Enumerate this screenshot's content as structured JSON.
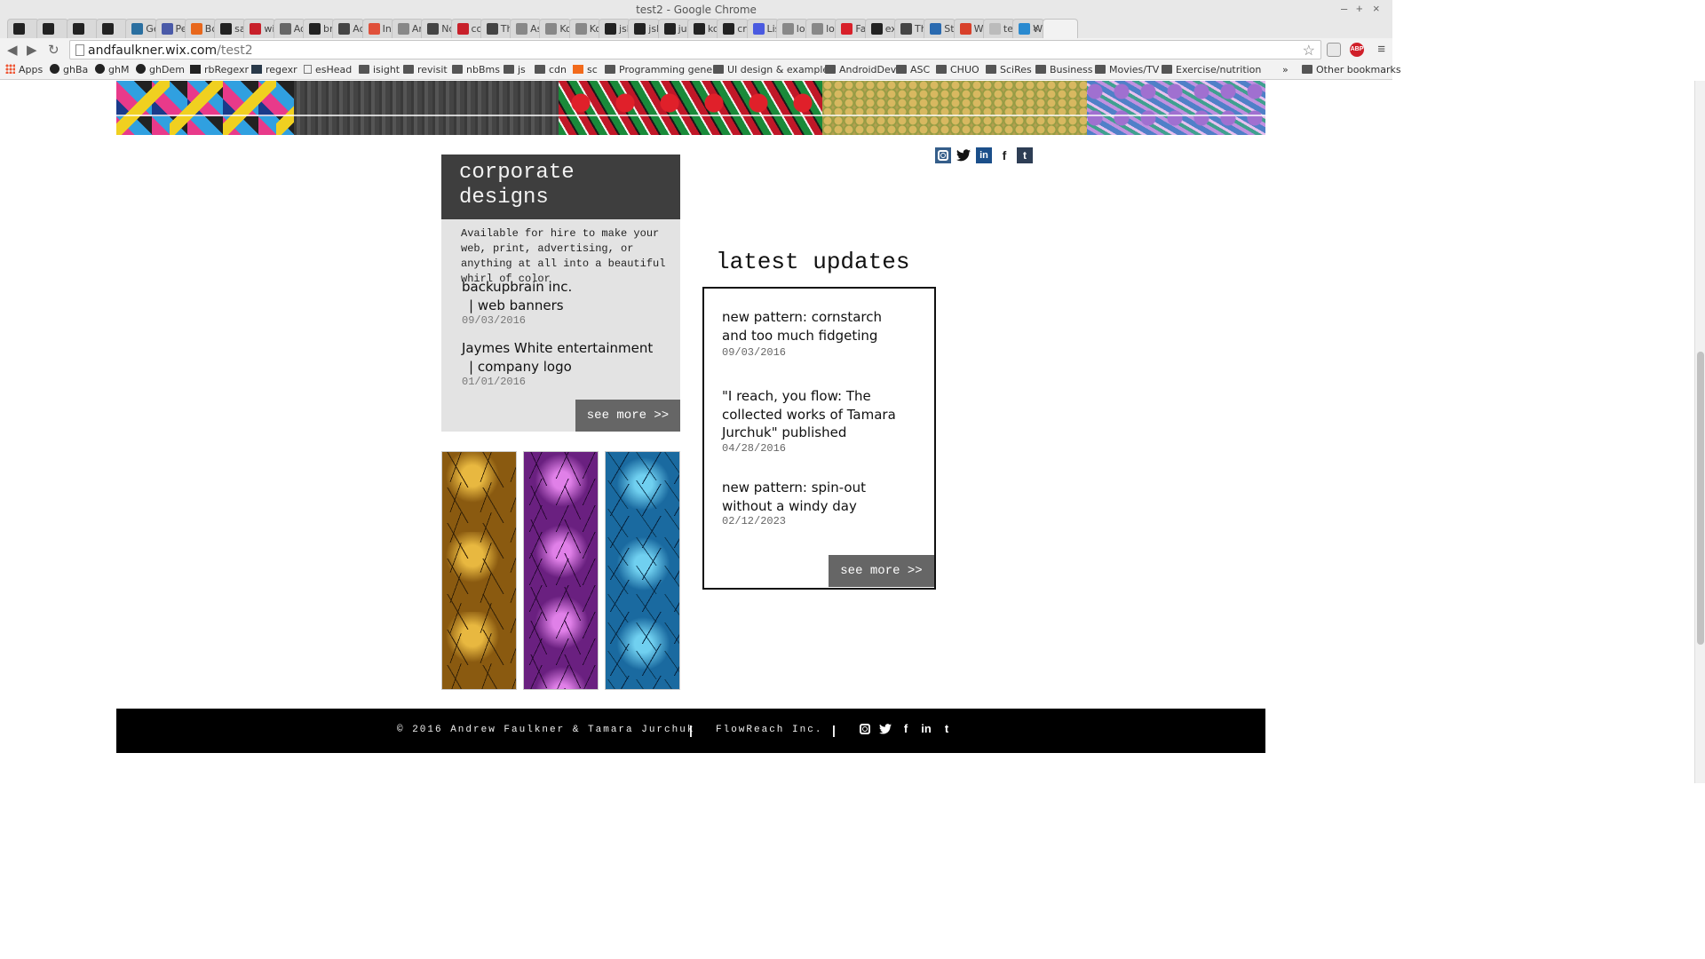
{
  "window": {
    "title": "test2 - Google Chrome",
    "minimize": "–",
    "maximize": "+",
    "close": "×"
  },
  "tabs": [
    {
      "label": "",
      "icon": "github-icon",
      "color": "#222222"
    },
    {
      "label": "",
      "icon": "lambda-icon",
      "color": "#222222"
    },
    {
      "label": "",
      "icon": "hackerrank-icon",
      "color": "#222222"
    },
    {
      "label": "",
      "icon": "book-icon",
      "color": "#222222"
    },
    {
      "label": "Ge",
      "icon": "react-icon",
      "color": "#2a6fa0"
    },
    {
      "label": "Per",
      "icon": "h-icon",
      "color": "#4a5aa8"
    },
    {
      "label": "Bo",
      "icon": "orange-circle-icon",
      "color": "#e8671c"
    },
    {
      "label": "sas",
      "icon": "github-icon",
      "color": "#222222"
    },
    {
      "label": "wi",
      "icon": "n-red-icon",
      "color": "#c8202a"
    },
    {
      "label": "Ad",
      "icon": "dos-icon",
      "color": "#666666"
    },
    {
      "label": "bro",
      "icon": "github-icon",
      "color": "#222222"
    },
    {
      "label": "Act",
      "icon": "book-icon",
      "color": "#444444"
    },
    {
      "label": "Intr",
      "icon": "plus-icon",
      "color": "#e0503a"
    },
    {
      "label": "An",
      "icon": "page-icon",
      "color": "#888888"
    },
    {
      "label": "No",
      "icon": "circle-2-icon",
      "color": "#444444"
    },
    {
      "label": "co",
      "icon": "n-red-icon",
      "color": "#c8202a"
    },
    {
      "label": "The",
      "icon": "book-icon",
      "color": "#444444"
    },
    {
      "label": "Asy",
      "icon": "page-icon",
      "color": "#888888"
    },
    {
      "label": "Ko",
      "icon": "page-icon",
      "color": "#888888"
    },
    {
      "label": "Ko",
      "icon": "page-icon",
      "color": "#888888"
    },
    {
      "label": "jsh",
      "icon": "github-icon",
      "color": "#222222"
    },
    {
      "label": "jsh",
      "icon": "github-icon",
      "color": "#222222"
    },
    {
      "label": "just",
      "icon": "github-icon",
      "color": "#222222"
    },
    {
      "label": "koa",
      "icon": "github-icon",
      "color": "#222222"
    },
    {
      "label": "cry",
      "icon": "github-icon",
      "color": "#222222"
    },
    {
      "label": "List",
      "icon": "blue-circle-icon",
      "color": "#4a5ae0"
    },
    {
      "label": "loc",
      "icon": "page-icon",
      "color": "#888888"
    },
    {
      "label": "loc",
      "icon": "page-icon",
      "color": "#888888"
    },
    {
      "label": "Fav",
      "icon": "f-red-icon",
      "color": "#d8202a"
    },
    {
      "label": "exp",
      "icon": "github-icon",
      "color": "#222222"
    },
    {
      "label": "Thr",
      "icon": "book-icon",
      "color": "#444444"
    },
    {
      "label": "Sto",
      "icon": "c-blue-icon",
      "color": "#2a6ab0"
    },
    {
      "label": "Wir",
      "icon": "gmail-icon",
      "color": "#d8402a"
    },
    {
      "label": "tes",
      "icon": "loading-icon",
      "color": "#bbbbbb"
    },
    {
      "label": "Wix",
      "icon": "x-blue-icon",
      "color": "#2a8ad0"
    },
    {
      "label": "",
      "icon": "active-tab",
      "color": "#f2f2f2"
    }
  ],
  "toolbar": {
    "url_host": "andfaulkner.wix.com",
    "url_path": "/test2",
    "back": "◀",
    "forward": "▶",
    "reload": "↻",
    "star": "☆",
    "menu": "≡",
    "adblock_label": "ABP",
    "adblock_color": "#d0202a"
  },
  "bookmarks": {
    "items": [
      {
        "label": "Apps",
        "icon": "apps-icon"
      },
      {
        "label": "ghBa",
        "icon": "github-icon"
      },
      {
        "label": "ghM",
        "icon": "github-icon"
      },
      {
        "label": "ghDem",
        "icon": "github-icon"
      },
      {
        "label": "rbRegexr",
        "icon": "r-icon"
      },
      {
        "label": "regexr",
        "icon": "regexr-icon"
      },
      {
        "label": "esHead",
        "icon": "page-icon"
      },
      {
        "label": "isight",
        "icon": "folder-icon"
      },
      {
        "label": "revisit",
        "icon": "folder-icon"
      },
      {
        "label": "nbBms",
        "icon": "folder-icon"
      },
      {
        "label": "js",
        "icon": "folder-icon"
      },
      {
        "label": "cdn",
        "icon": "folder-icon"
      },
      {
        "label": "sc",
        "icon": "soundcloud-icon"
      },
      {
        "label": "Programming genera",
        "icon": "folder-icon"
      },
      {
        "label": "UI design & example",
        "icon": "folder-icon"
      },
      {
        "label": "AndroidDev",
        "icon": "folder-icon"
      },
      {
        "label": "ASC",
        "icon": "folder-icon"
      },
      {
        "label": "CHUO",
        "icon": "folder-icon"
      },
      {
        "label": "SciRes",
        "icon": "folder-icon"
      },
      {
        "label": "Business",
        "icon": "folder-icon"
      },
      {
        "label": "Movies/TV",
        "icon": "folder-icon"
      },
      {
        "label": "Exercise/nutrition",
        "icon": "folder-icon"
      }
    ],
    "overflow": "»",
    "other": "Other bookmarks"
  },
  "corporate": {
    "title_line1": "corporate",
    "title_line2": "designs",
    "description": "Available for hire to make your web, print, advertising, or anything at all into a beautiful whirl of color",
    "items": [
      {
        "title_line1": "backupbrain inc.",
        "title_line2": "| web banners",
        "date": "09/03/2016"
      },
      {
        "title_line1": "Jaymes White entertainment",
        "title_line2": "| company logo",
        "date": "01/01/2016"
      }
    ],
    "see_more": "see more >>"
  },
  "latest_updates": {
    "heading": "latest updates",
    "items": [
      {
        "title": "new pattern: cornstarch and too much fidgeting",
        "date": "09/03/2016"
      },
      {
        "title": "\"I reach, you flow: The collected works of Tamara Jurchuk\" published",
        "date": "04/28/2016"
      },
      {
        "title": "new pattern: spin-out without a windy day",
        "date": "02/12/2023"
      }
    ],
    "see_more": "see more >>"
  },
  "social": {
    "instagram": "instagram-icon",
    "twitter": "twitter-icon",
    "linkedin": "in",
    "facebook": "f",
    "tumblr": "t"
  },
  "footer": {
    "copyright": "© 2016 Andrew Faulkner & Tamara Jurchuk",
    "separator": "|",
    "company": "FlowReach Inc."
  }
}
